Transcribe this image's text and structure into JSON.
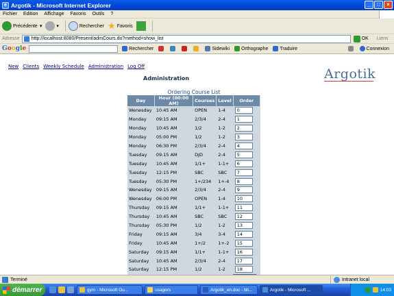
{
  "window": {
    "title": "Argotik - Microsoft Internet Explorer",
    "controls": [
      "_",
      "□",
      "×"
    ]
  },
  "menu": [
    "Fichier",
    "Edition",
    "Affichage",
    "Favoris",
    "Outils",
    "?"
  ],
  "toolbar": {
    "back": "Précédente",
    "search": "Rechercher",
    "favorites": "Favoris"
  },
  "address": {
    "label": "Adresse",
    "url": "http://localhost:8080/Present/admCours.do?method=show_list",
    "go": "OK",
    "links": "Liens"
  },
  "google": {
    "logo": "Google",
    "search": "Rechercher",
    "sidewiki": "Sidewiki",
    "spelling": "Orthographe",
    "translate": "Traduire",
    "login": "Connexion"
  },
  "nav": [
    "New",
    "Clients",
    "Weekly Schedule",
    "Administration",
    "Log Off"
  ],
  "brand": "Argotik",
  "page": {
    "title": "Administration",
    "table_caption": "Ordering Course List",
    "columns": [
      "Day",
      "Hour (00:00 AM)",
      "Courses",
      "Level",
      "Order"
    ],
    "rows": [
      [
        "Wenesday",
        "10:45 AM",
        "OPEN",
        "1-4",
        "0"
      ],
      [
        "Monday",
        "09:15 AM",
        "2/3/4",
        "2-4",
        "1"
      ],
      [
        "Monday",
        "10:45 AM",
        "1/2",
        "1-2",
        "2"
      ],
      [
        "Monday",
        "05:00 PM",
        "1/2",
        "1-2",
        "3"
      ],
      [
        "Monday",
        "06:30 PM",
        "2/3/4",
        "2-4",
        "4"
      ],
      [
        "Tuesday",
        "09:15 AM",
        "DJD",
        "2-4",
        "5"
      ],
      [
        "Tuesday",
        "10:45 AM",
        "1/1+",
        "1-1+",
        "6"
      ],
      [
        "Tuesday",
        "12:15 PM",
        "SBC",
        "SBC",
        "7"
      ],
      [
        "Tuesday",
        "05:30 PM",
        "1+/234",
        "1+-4",
        "8"
      ],
      [
        "Wenesday",
        "09:15 AM",
        "2/3/4",
        "2-4",
        "9"
      ],
      [
        "Wenesday",
        "06:00 PM",
        "OPEN",
        "1-4",
        "10"
      ],
      [
        "Thursday",
        "09:15 AM",
        "1/1+",
        "1-1+",
        "11"
      ],
      [
        "Thursday",
        "10:45 AM",
        "SBC",
        "SBC",
        "12"
      ],
      [
        "Thursday",
        "05:30 PM",
        "1/2",
        "1-2",
        "13"
      ],
      [
        "Friday",
        "09:15 AM",
        "3/4",
        "3-4",
        "14"
      ],
      [
        "Friday",
        "10:45 AM",
        "1+/2",
        "1+-2",
        "15"
      ],
      [
        "Saturday",
        "09:15 AM",
        "1/1+",
        "1-1+",
        "16"
      ],
      [
        "Saturday",
        "10:45 AM",
        "2/3/4",
        "2-4",
        "17"
      ],
      [
        "Saturday",
        "12:15 PM",
        "1/2",
        "1-2",
        "18"
      ]
    ]
  },
  "status": {
    "text": "Terminé",
    "zone": "Intranet local"
  },
  "taskbar": {
    "start": "démarrer",
    "tasks": [
      "gym - Microsoft Ou...",
      "usagers",
      "Argotik_en.doc - Mi...",
      "Argotik - Microsoft ..."
    ],
    "clock": "14:03"
  },
  "colors": {
    "title_bar": "#0048d8",
    "header_row": "#6c8aa8",
    "table_bg": "#cfd7e1",
    "link": "#000080"
  }
}
